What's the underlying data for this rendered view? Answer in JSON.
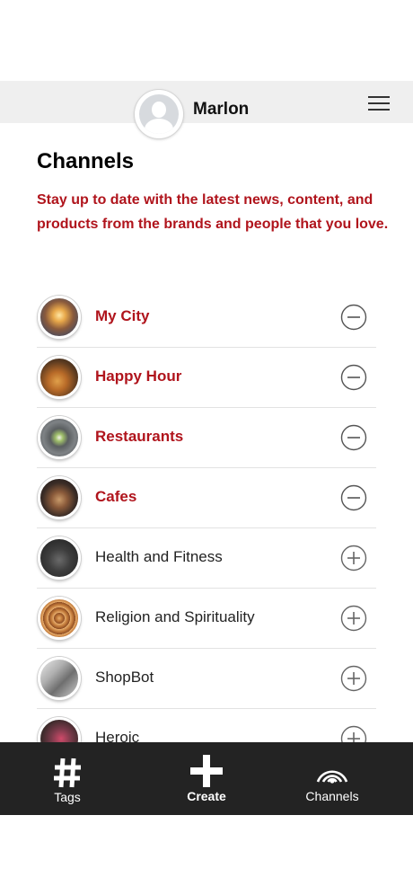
{
  "header": {
    "user_name": "Marlon"
  },
  "page": {
    "title": "Channels",
    "intro": "Stay up to date with the latest news, content, and products from the brands and people that you love."
  },
  "channels": [
    {
      "name": "My City",
      "subscribed": true,
      "action_icon": "minus-circle-icon"
    },
    {
      "name": "Happy Hour",
      "subscribed": true,
      "action_icon": "minus-circle-icon"
    },
    {
      "name": "Restaurants",
      "subscribed": true,
      "action_icon": "minus-circle-icon"
    },
    {
      "name": "Cafes",
      "subscribed": true,
      "action_icon": "minus-circle-icon"
    },
    {
      "name": "Health and Fitness",
      "subscribed": false,
      "action_icon": "plus-circle-icon"
    },
    {
      "name": "Religion and Spirituality",
      "subscribed": false,
      "action_icon": "plus-circle-icon"
    },
    {
      "name": "ShopBot",
      "subscribed": false,
      "action_icon": "plus-circle-icon"
    },
    {
      "name": "Heroic",
      "subscribed": false,
      "action_icon": "plus-circle-icon"
    }
  ],
  "tabbar": {
    "tags_label": "Tags",
    "create_label": "Create",
    "channels_label": "Channels"
  },
  "colors": {
    "accent": "#b0141c",
    "tabbar_background": "#232323",
    "header_background": "#efefef"
  }
}
